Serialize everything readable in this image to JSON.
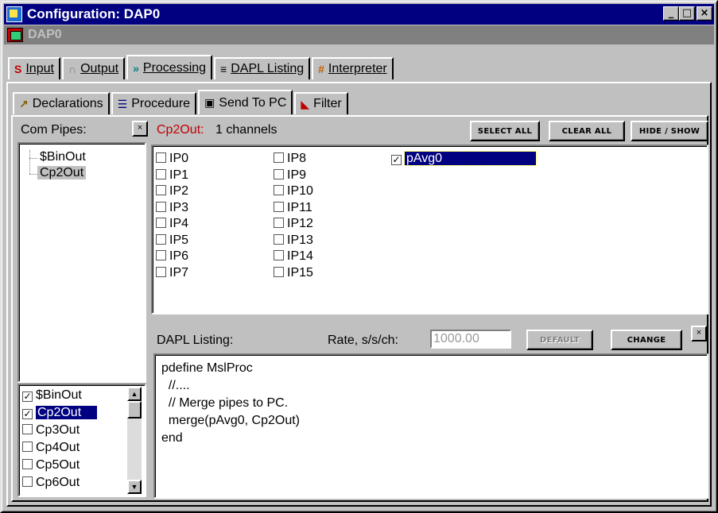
{
  "window": {
    "title": "Configuration: DAP0",
    "subtitle": "DAP0",
    "buttons": {
      "minimize": "_",
      "maximize": "□",
      "close": "×"
    }
  },
  "main_tabs": [
    {
      "icon": "S",
      "label": "Input",
      "active": false
    },
    {
      "icon": "∩",
      "label": "Output",
      "active": false
    },
    {
      "icon": "»",
      "label": "Processing",
      "active": true
    },
    {
      "icon": "≡",
      "label": "DAPL Listing",
      "active": false
    },
    {
      "icon": "#",
      "label": "Interpreter",
      "active": false
    }
  ],
  "sub_tabs": [
    {
      "icon": "↗",
      "label": "Declarations",
      "active": false
    },
    {
      "icon": "☰",
      "label": "Procedure",
      "active": false
    },
    {
      "icon": "▣",
      "label": "Send To PC",
      "active": true
    },
    {
      "icon": "◣",
      "label": "Filter",
      "active": false
    }
  ],
  "com_pipes": {
    "label": "Com Pipes:",
    "close": "×",
    "tree": [
      {
        "label": "$BinOut",
        "selected": false
      },
      {
        "label": "Cp2Out",
        "selected": true
      }
    ],
    "list": [
      {
        "label": "$BinOut",
        "checked": true,
        "selected": false
      },
      {
        "label": "Cp2Out",
        "checked": true,
        "selected": true
      },
      {
        "label": "Cp3Out",
        "checked": false,
        "selected": false
      },
      {
        "label": "Cp4Out",
        "checked": false,
        "selected": false
      },
      {
        "label": "Cp5Out",
        "checked": false,
        "selected": false
      },
      {
        "label": "Cp6Out",
        "checked": false,
        "selected": false
      }
    ]
  },
  "channels": {
    "pipe_label": "Cp2Out:",
    "count_text": "1 channels",
    "pipe_color": "#c00000",
    "select_all": "SELECT ALL",
    "clear_all": "CLEAR ALL",
    "hide_show": "HIDE / SHOW",
    "columns": [
      [
        "IP0",
        "IP1",
        "IP2",
        "IP3",
        "IP4",
        "IP5",
        "IP6",
        "IP7"
      ],
      [
        "IP8",
        "IP9",
        "IP10",
        "IP11",
        "IP12",
        "IP13",
        "IP14",
        "IP15"
      ],
      [
        "pAvg0"
      ]
    ],
    "checked": [
      "pAvg0"
    ]
  },
  "dapl": {
    "label": "DAPL Listing:",
    "rate_label": "Rate, s/s/ch:",
    "rate_value": "1000.00",
    "default_btn": "DEFAULT",
    "change_btn": "CHANGE",
    "close": "×",
    "code": [
      "pdefine MslProc",
      "  //....",
      "  // Merge pipes to PC.",
      "  merge(pAvg0, Cp2Out)",
      "end"
    ]
  }
}
